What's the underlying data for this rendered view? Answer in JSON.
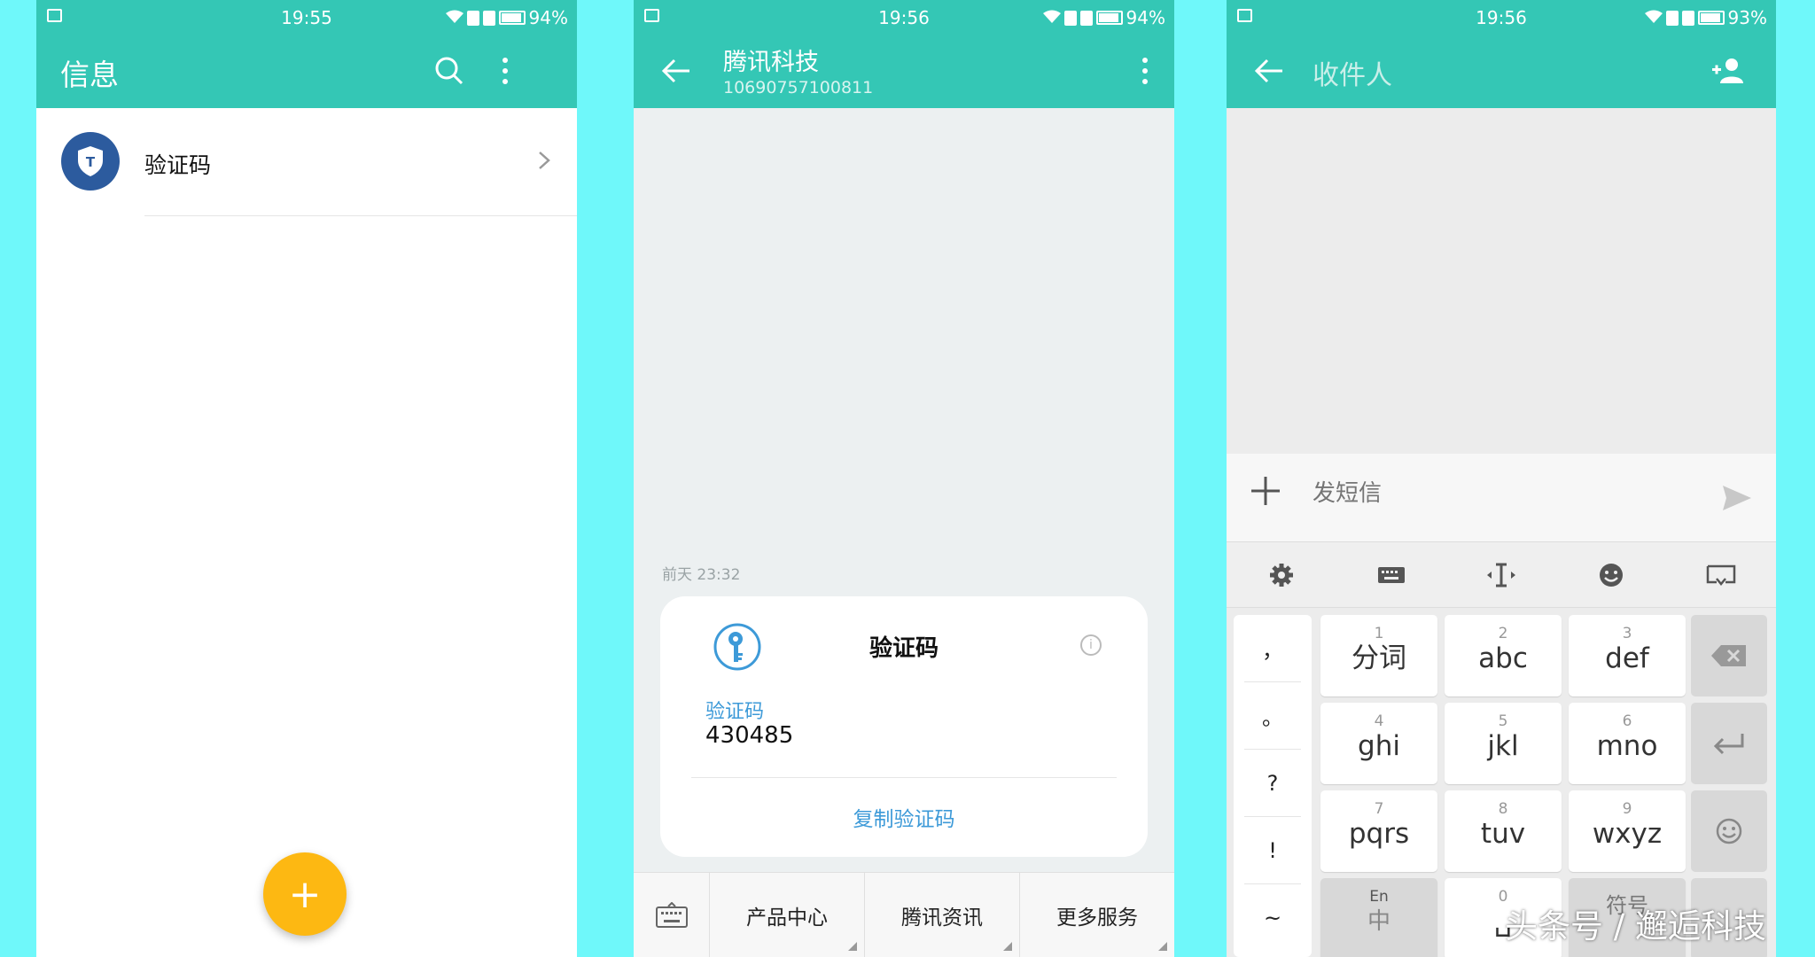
{
  "colors": {
    "page_bg": "#6ff8fa",
    "app_bar": "#34c7b5",
    "fab": "#fdb812",
    "accent_blue": "#3d9ad8",
    "avatar": "#2c5b9e"
  },
  "screen1": {
    "status": {
      "time": "19:55",
      "battery": "94%"
    },
    "title": "信息",
    "actions": [
      "search-icon",
      "more-vert-icon"
    ],
    "conversations": [
      {
        "name": "验证码",
        "avatar_icon": "shield-icon"
      }
    ],
    "fab_label": "+"
  },
  "screen2": {
    "status": {
      "time": "19:56",
      "battery": "94%"
    },
    "contact_name": "腾讯科技",
    "contact_number": "10690757100811",
    "timestamp": "前天 23:32",
    "card": {
      "title": "验证码",
      "code_label": "验证码",
      "code_value": "430485",
      "action": "复制验证码"
    },
    "menu": [
      "产品中心",
      "腾讯资讯",
      "更多服务"
    ]
  },
  "screen3": {
    "status": {
      "time": "19:56",
      "battery": "93%"
    },
    "recipient_placeholder": "收件人",
    "compose_placeholder": "发短信",
    "keyboard": {
      "toolbar": [
        "gear-icon",
        "keyboard-icon",
        "cursor-icon",
        "emoji-icon",
        "hide-keyboard-icon"
      ],
      "punctuation": [
        "，",
        "。",
        "?",
        "!",
        "~"
      ],
      "keys": [
        {
          "num": "1",
          "label": "分词"
        },
        {
          "num": "2",
          "label": "abc"
        },
        {
          "num": "3",
          "label": "def"
        },
        {
          "num": "4",
          "label": "ghi"
        },
        {
          "num": "5",
          "label": "jkl"
        },
        {
          "num": "6",
          "label": "mno"
        },
        {
          "num": "7",
          "label": "pqrs"
        },
        {
          "num": "8",
          "label": "tuv"
        },
        {
          "num": "9",
          "label": "wxyz"
        },
        {
          "num": "En",
          "label": "中"
        },
        {
          "num": "0",
          "label": "␣"
        },
        {
          "num": "",
          "label": "符号"
        }
      ]
    }
  },
  "watermark": "头条号 / 邂逅科技"
}
